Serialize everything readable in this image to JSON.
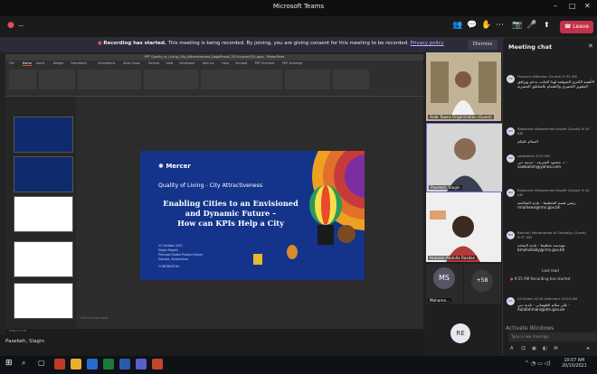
{
  "window": {
    "title": "Microsoft Teams",
    "minimize": "–",
    "maximize": "□",
    "close": "✕"
  },
  "toolbar": {
    "timer": "—",
    "participants_count": "+58",
    "leave_label": "Leave"
  },
  "banner": {
    "bold": "Recording has started.",
    "text": " This meeting is being recorded. By joining, you are giving consent for this meeting to be recorded. ",
    "link": "Privacy policy",
    "dismiss": "Dismiss"
  },
  "powerpoint": {
    "window_title": "PPT Quality_of_Living_City_Attractiveness_NagoProsol_20 Ecuador(V5).pptx - PowerPoint",
    "tabs": [
      "File",
      "Home",
      "Insert",
      "Design",
      "Transitions",
      "Animations",
      "Slide Show",
      "Review",
      "View",
      "Developer",
      "Add-ins",
      "Help",
      "Acrobat",
      "PDF Element",
      "PDF Xchange"
    ],
    "notes_hint": "Click to add notes",
    "status": "Slide 4 of 28"
  },
  "slide": {
    "brand": "Mercer",
    "subtitle": "Quality of Living - City Attractiveness",
    "heading_1": "Enabling Cities to an Envisioned",
    "heading_2": "and Dynamic Future –",
    "heading_3": "How can KPIs Help a City",
    "date": "21 October 2021",
    "presenter": "Slagin Pasekh",
    "role": "Principal Global Product Owner",
    "location": "Geneva, Switzerland",
    "brand_small": "MERCER",
    "confidential": "CONFIDENTIAL"
  },
  "presenter_name": "Pasekeh, Slagin",
  "participants": [
    {
      "name": "Arab Towns Organization (Guest)"
    },
    {
      "name": "Pasekeh, Slagin"
    },
    {
      "name": "Hussain Abdulla Rasdan"
    },
    {
      "initials": "MS",
      "name": "Mohame..."
    },
    {
      "more": "+58"
    },
    {
      "initials": "RE"
    }
  ],
  "chat": {
    "title": "Meeting chat",
    "messages": [
      {
        "initials": "HR",
        "who": "Hussain alRasdan (Guest)  9:32 AM",
        "body": "الأهمية الكبرى المتوقعة لهذا الجانب يدعم ويرافق التطوير الحضري والاهتمام بالمناطق الحضرية"
      },
      {
        "initials": "RM",
        "who": "Rajkumar Mohammed Alsaifi (Guest)  9:34 AM",
        "body": "السلام عليكم"
      },
      {
        "initials": "SW",
        "who": "sawbahsh  9:33 AM",
        "body": "د. محمود الشريف - مدينة دبي - sawbahsh@yahoo.com"
      },
      {
        "initials": "RM",
        "who": "Rajkumar Mohammed Alsaifi (Guest)  9:34 AM",
        "body": "رئيس قسم التخطيط - بلدية الصالحية rmarkeen@rms.gov.bh"
      },
      {
        "initials": "BM",
        "who": "Bahrain Mohammad Al Shahaby (Guest)  9:37 AM",
        "body": "مهندسة تخطيط - بلدية المنامة bmohahaby@rms.gov.bh"
      }
    ],
    "last_read": "Last read",
    "system": "9:55 AM  Recording has started",
    "last_message": {
      "initials": "AA",
      "who": "Ali Salem Ali Al Dahmani  10:04 AM",
      "body": "علي سالم الظهماني - بلدية دبي - Aalidahmani@dm.gov.ae"
    },
    "compose_placeholder": "Type a new message",
    "watermark": "Activate Windows"
  },
  "taskbar": {
    "time": "10:07 AM",
    "date": "20/10/2021"
  }
}
